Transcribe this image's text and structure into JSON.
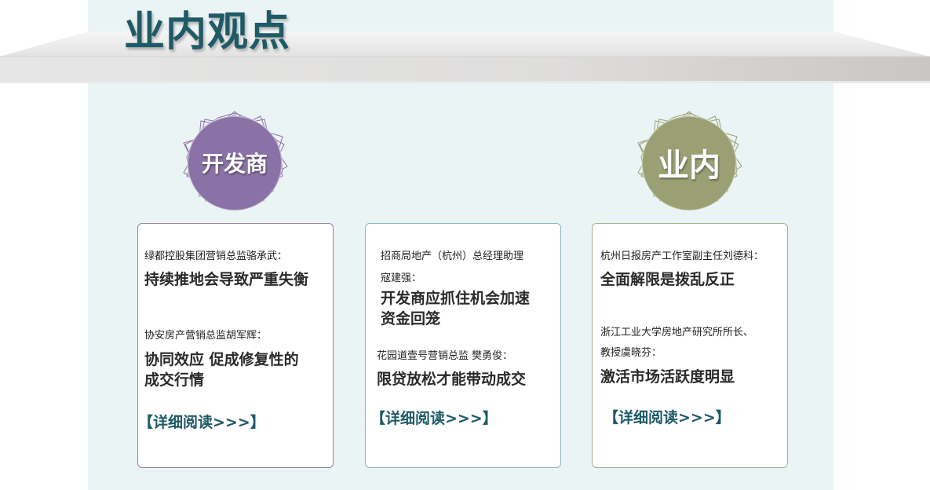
{
  "page": {
    "title": "业内观点"
  },
  "badges": {
    "left": {
      "label": "开发商",
      "color": "#8a72a6"
    },
    "right": {
      "label": "业内",
      "color": "#9aa074"
    }
  },
  "cards": [
    {
      "border": "#8e82aa",
      "entries": [
        {
          "name": "绿都控股集团营销总监骆承武：",
          "quote": "持续推地会导致严重失衡"
        },
        {
          "name": "协安房产营销总监胡军辉：",
          "quote": "协同效应 促成修复性的\n成交行情"
        }
      ],
      "more": "【详细阅读>>>】"
    },
    {
      "border": "#87b6bd",
      "entries": [
        {
          "name": "招商局地产（杭州）总经理助理\n寇建强：",
          "quote": "开发商应抓住机会加速\n资金回笼"
        },
        {
          "name": "花园道壹号营销总监 樊勇俊：",
          "quote": "限贷放松才能带动成交"
        }
      ],
      "more": "【详细阅读>>>】"
    },
    {
      "border": "#a3b08a",
      "entries": [
        {
          "name": "杭州日报房产工作室副主任刘德科：",
          "quote": "全面解限是拨乱反正"
        },
        {
          "name": "浙江工业大学房地产研究所所长、\n教授虞晓芬：",
          "quote": "激活市场活跃度明显"
        }
      ],
      "more": "【详细阅读>>>】"
    }
  ]
}
